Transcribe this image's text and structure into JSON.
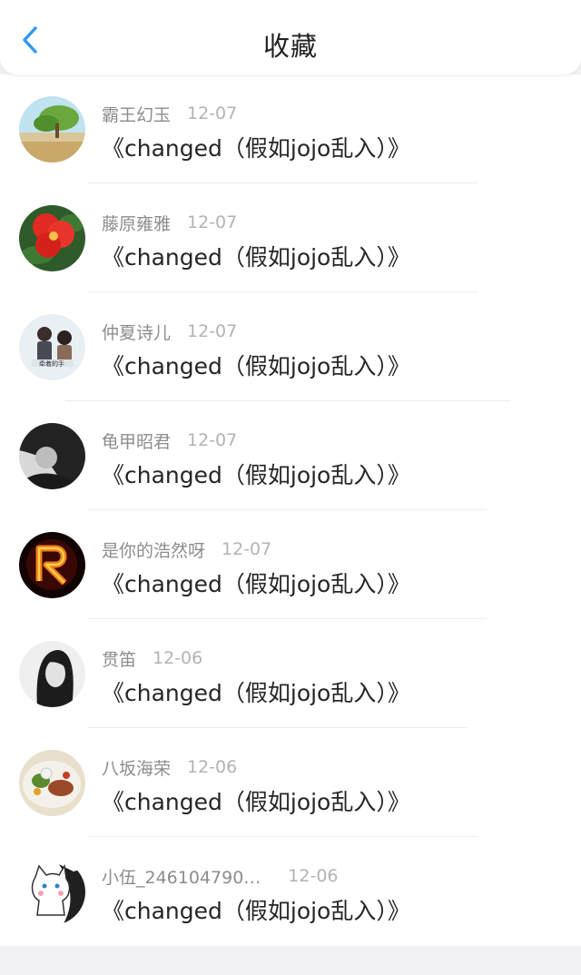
{
  "header": {
    "title": "收藏",
    "back_icon": "chevron-left-icon",
    "accent": "#2f9cf0"
  },
  "items": [
    {
      "name": "霸王幻玉",
      "date": "12-07",
      "title": "《changed（假如jojo乱入）》",
      "avatar": "landscape-tree"
    },
    {
      "name": "藤原雍雅",
      "date": "12-07",
      "title": "《changed（假如jojo乱入）》",
      "avatar": "red-hibiscus"
    },
    {
      "name": "仲夏诗儿",
      "date": "12-07",
      "title": "《changed（假如jojo乱入）》",
      "avatar": "couple-photo"
    },
    {
      "name": "龟甲昭君",
      "date": "12-07",
      "title": "《changed（假如jojo乱入）》",
      "avatar": "dark-portrait"
    },
    {
      "name": "是你的浩然呀",
      "date": "12-07",
      "title": "《changed（假如jojo乱入）》",
      "avatar": "fire-letter-r"
    },
    {
      "name": "贯笛",
      "date": "12-06",
      "title": "《changed（假如jojo乱入）》",
      "avatar": "girl-portrait"
    },
    {
      "name": "八坂海荣",
      "date": "12-06",
      "title": "《changed（假如jojo乱入）》",
      "avatar": "food-plate"
    },
    {
      "name": "小伍_246104790…",
      "date": "12-06",
      "title": "《changed（假如jojo乱入）》",
      "avatar": "cartoon-cat"
    }
  ]
}
